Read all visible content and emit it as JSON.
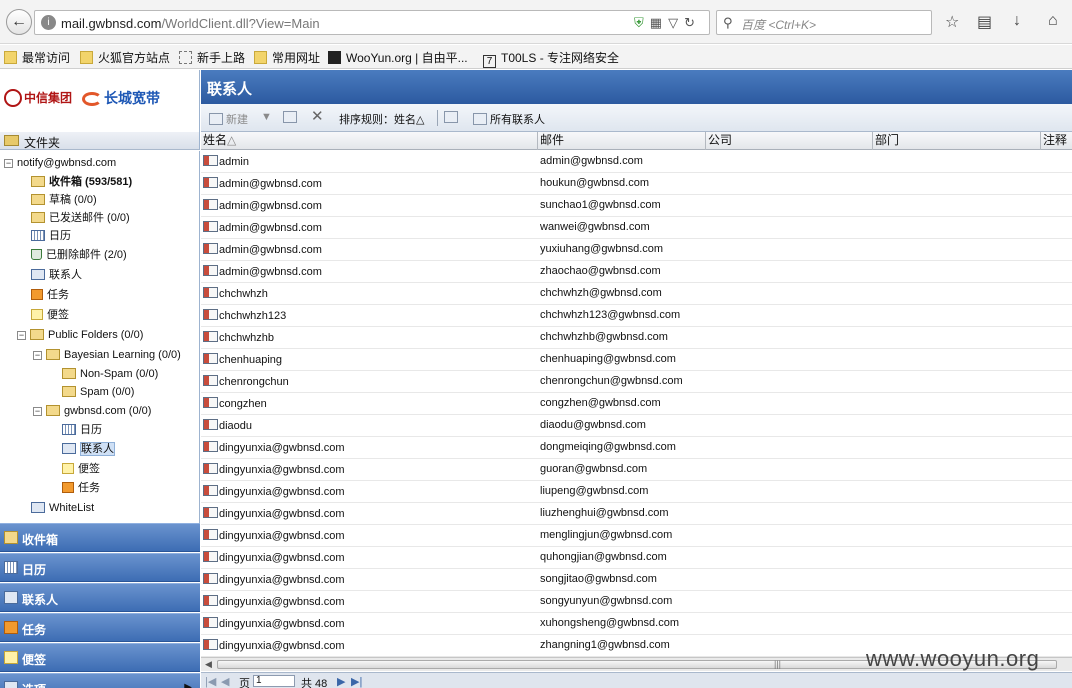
{
  "browser": {
    "url_host": "mail.gwbnsd.com",
    "url_path": "/WorldClient.dll?View=Main",
    "search_placeholder": "百度 <Ctrl+K>",
    "bookmarks": [
      "最常访问",
      "火狐官方站点",
      "新手上路",
      "常用网址",
      "WooYun.org | 自由平...",
      "T00LS - 专注网络安全"
    ]
  },
  "logo": {
    "citic": "中信集团",
    "gw": "长城宽带"
  },
  "page": {
    "title": "联系人"
  },
  "toolbar": {
    "new_label": "新建",
    "sort_label": "排序规则：",
    "sort_value": "姓名",
    "all_contacts_label": "所有联系人"
  },
  "folders": {
    "header": "文件夹",
    "tree": [
      {
        "label": "notify@gwbnsd.com",
        "icon": "minus-toggle"
      },
      {
        "label": "收件箱 (593/581)",
        "icon": "mail-folder-icon"
      },
      {
        "label": "草稿 (0/0)",
        "icon": "mail-folder-icon"
      },
      {
        "label": "已发送邮件 (0/0)",
        "icon": "mail-folder-icon"
      },
      {
        "label": "日历",
        "icon": "calendar-icon"
      },
      {
        "label": "已删除邮件 (2/0)",
        "icon": "trash-icon"
      },
      {
        "label": "联系人",
        "icon": "contacts-icon"
      },
      {
        "label": "任务",
        "icon": "tasks-icon"
      },
      {
        "label": "便签",
        "icon": "notes-icon"
      },
      {
        "label": "Public Folders (0/0)",
        "icon": "mail-folder-icon"
      },
      {
        "label": "Bayesian Learning (0/0)",
        "icon": "mail-folder-icon"
      },
      {
        "label": "Non-Spam (0/0)",
        "icon": "mail-folder-icon"
      },
      {
        "label": "Spam (0/0)",
        "icon": "mail-folder-icon"
      },
      {
        "label": "gwbnsd.com (0/0)",
        "icon": "mail-folder-icon"
      },
      {
        "label": "日历",
        "icon": "calendar-icon"
      },
      {
        "label": "联系人",
        "icon": "contacts-icon"
      },
      {
        "label": "便签",
        "icon": "notes-icon"
      },
      {
        "label": "任务",
        "icon": "tasks-icon"
      },
      {
        "label": "WhiteList",
        "icon": "contacts-icon"
      }
    ]
  },
  "nav": [
    "收件箱",
    "日历",
    "联系人",
    "任务",
    "便签",
    "选项"
  ],
  "grid": {
    "columns": [
      "姓名",
      "邮件",
      "公司",
      "部门",
      "注释"
    ],
    "rows": [
      {
        "name": "admin",
        "email": "admin@gwbnsd.com"
      },
      {
        "name": "admin@gwbnsd.com",
        "email": "houkun@gwbnsd.com"
      },
      {
        "name": "admin@gwbnsd.com",
        "email": "sunchao1@gwbnsd.com"
      },
      {
        "name": "admin@gwbnsd.com",
        "email": "wanwei@gwbnsd.com"
      },
      {
        "name": "admin@gwbnsd.com",
        "email": "yuxiuhang@gwbnsd.com"
      },
      {
        "name": "admin@gwbnsd.com",
        "email": "zhaochao@gwbnsd.com"
      },
      {
        "name": "chchwhzh",
        "email": "chchwhzh@gwbnsd.com"
      },
      {
        "name": "chchwhzh123",
        "email": "chchwhzh123@gwbnsd.com"
      },
      {
        "name": "chchwhzhb",
        "email": "chchwhzhb@gwbnsd.com"
      },
      {
        "name": "chenhuaping",
        "email": "chenhuaping@gwbnsd.com"
      },
      {
        "name": "chenrongchun",
        "email": "chenrongchun@gwbnsd.com"
      },
      {
        "name": "congzhen",
        "email": "congzhen@gwbnsd.com"
      },
      {
        "name": "diaodu",
        "email": "diaodu@gwbnsd.com"
      },
      {
        "name": "dingyunxia@gwbnsd.com",
        "email": "dongmeiqing@gwbnsd.com"
      },
      {
        "name": "dingyunxia@gwbnsd.com",
        "email": "guoran@gwbnsd.com"
      },
      {
        "name": "dingyunxia@gwbnsd.com",
        "email": "liupeng@gwbnsd.com"
      },
      {
        "name": "dingyunxia@gwbnsd.com",
        "email": "liuzhenghui@gwbnsd.com"
      },
      {
        "name": "dingyunxia@gwbnsd.com",
        "email": "menglingjun@gwbnsd.com"
      },
      {
        "name": "dingyunxia@gwbnsd.com",
        "email": "quhongjian@gwbnsd.com"
      },
      {
        "name": "dingyunxia@gwbnsd.com",
        "email": "songjitao@gwbnsd.com"
      },
      {
        "name": "dingyunxia@gwbnsd.com",
        "email": "songyunyun@gwbnsd.com"
      },
      {
        "name": "dingyunxia@gwbnsd.com",
        "email": "xuhongsheng@gwbnsd.com"
      },
      {
        "name": "dingyunxia@gwbnsd.com",
        "email": "zhangning1@gwbnsd.com"
      }
    ]
  },
  "pager": {
    "page_prefix": "页",
    "page_value": "1",
    "total": "共 48"
  },
  "watermark": "www.wooyun.org"
}
